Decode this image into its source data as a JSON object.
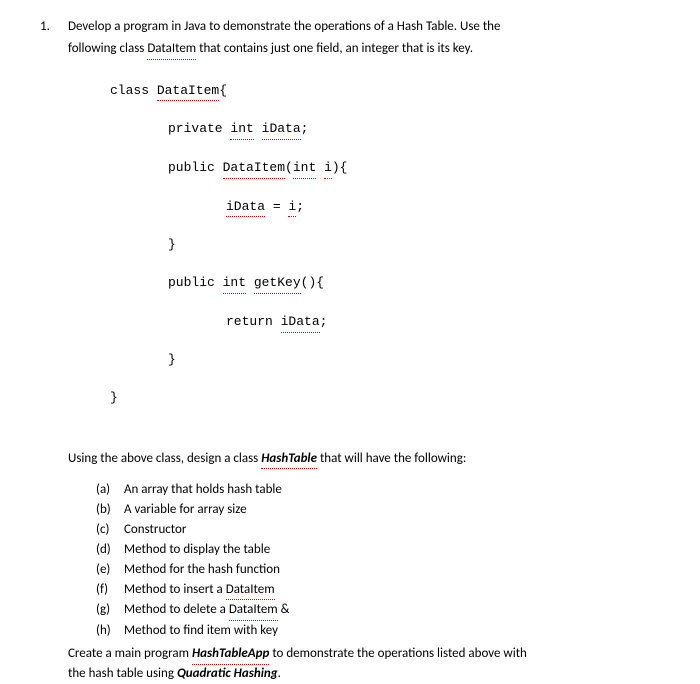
{
  "problem_number": "1.",
  "intro_1": "Develop a program in Java to demonstrate the operations of a Hash Table.  Use the",
  "intro_2a": "following class ",
  "intro_2b": "DataItem",
  "intro_2c": " that contains just one field, an integer that is its key.",
  "code": {
    "l1a": "class ",
    "l1b": "DataItem",
    "l1c": "{",
    "l2a": "private ",
    "l2b": "int",
    "l2c": " ",
    "l2d": "iData",
    "l2e": ";",
    "l3a": "public ",
    "l3b": "DataItem",
    "l3c": "(",
    "l3d": "int",
    "l3e": " ",
    "l3f": "i",
    "l3g": "){",
    "l4a": "iData",
    "l4b": " = ",
    "l4c": "i",
    "l4d": ";",
    "l5": "}",
    "l6a": "public ",
    "l6b": "int",
    "l6c": " ",
    "l6d": "getKey",
    "l6e": "(){",
    "l7a": "return ",
    "l7b": "iData",
    "l7c": ";",
    "l8": "}",
    "l9": "}"
  },
  "sub_1a": "Using the above class, design a class ",
  "sub_1b": "HashTable",
  "sub_1c": " that will have the following:",
  "items": [
    {
      "label": "(a)",
      "text": "An array that holds hash table"
    },
    {
      "label": "(b)",
      "text": "A variable for array size"
    },
    {
      "label": "(c)",
      "text": "Constructor"
    },
    {
      "label": "(d)",
      "text": "Method to display the table"
    },
    {
      "label": "(e)",
      "text": "Method for the hash function"
    }
  ],
  "item_f": {
    "label": "(f)",
    "pre": "Method to insert a ",
    "sq": "DataItem"
  },
  "item_g": {
    "label": "(g)",
    "pre": "Method to delete a ",
    "sq": "DataItem",
    "post": " &"
  },
  "item_h": {
    "label": "(h)",
    "text": "Method to find item with key"
  },
  "footer_1a": "Create a main program ",
  "footer_1b": "HashTableApp",
  "footer_1c": " to demonstrate the operations listed above with",
  "footer_2a": "the hash table using ",
  "footer_2b": "Quadratic Hashing",
  "footer_2c": "."
}
